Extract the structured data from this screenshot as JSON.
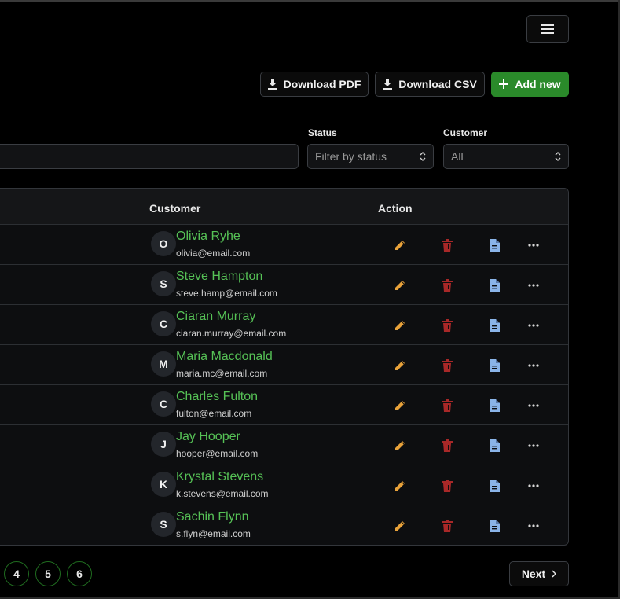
{
  "toolbar": {
    "download_pdf": "Download PDF",
    "download_csv": "Download CSV",
    "add_new": "Add new"
  },
  "filters": {
    "status_label": "Status",
    "status_placeholder": "Filter by status",
    "customer_label": "Customer",
    "customer_value": "All"
  },
  "table": {
    "headers": {
      "customer": "Customer",
      "action": "Action"
    },
    "rows": [
      {
        "initial": "O",
        "name": "Olivia Ryhe",
        "email": "olivia@email.com"
      },
      {
        "initial": "S",
        "name": "Steve Hampton",
        "email": "steve.hamp@email.com"
      },
      {
        "initial": "C",
        "name": "Ciaran Murray",
        "email": "ciaran.murray@email.com"
      },
      {
        "initial": "M",
        "name": "Maria Macdonald",
        "email": "maria.mc@email.com"
      },
      {
        "initial": "C",
        "name": "Charles Fulton",
        "email": "fulton@email.com"
      },
      {
        "initial": "J",
        "name": "Jay Hooper",
        "email": "hooper@email.com"
      },
      {
        "initial": "K",
        "name": "Krystal Stevens",
        "email": "k.stevens@email.com"
      },
      {
        "initial": "S",
        "name": "Sachin Flynn",
        "email": "s.flyn@email.com"
      }
    ],
    "action_icons": [
      "pencil-icon",
      "trash-icon",
      "document-icon",
      "more-horizontal-icon"
    ]
  },
  "pagination": {
    "pages": [
      "4",
      "5",
      "6"
    ],
    "next": "Next"
  },
  "colors": {
    "accent_green": "#2a8a2a",
    "name_green": "#56c256",
    "edit_orange": "#e8a23a",
    "delete_red": "#a82828",
    "doc_blue": "#8ab4e8"
  }
}
